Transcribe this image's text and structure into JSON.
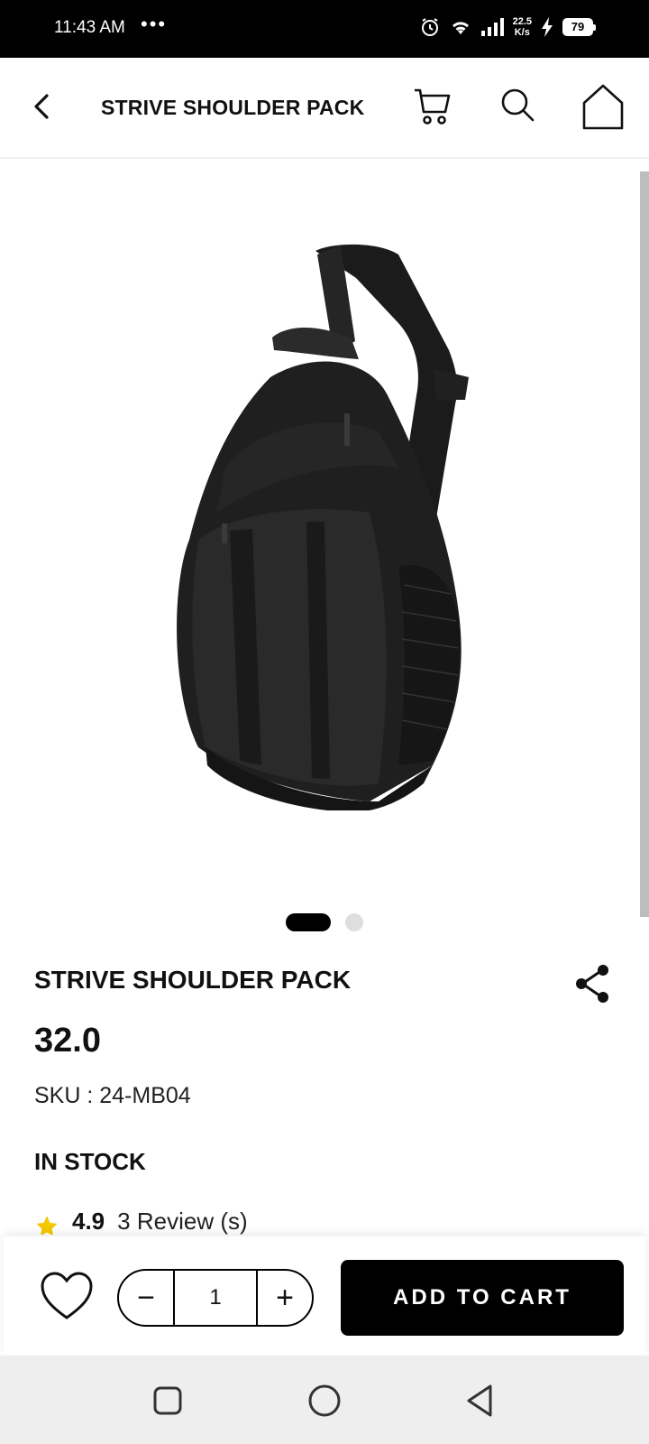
{
  "status_bar": {
    "time": "11:43 AM",
    "dots": "•••",
    "net_speed_value": "22.5",
    "net_speed_unit": "K/s",
    "battery": "79"
  },
  "header": {
    "title": "STRIVE SHOULDER PACK",
    "icons": [
      "back-icon",
      "cart-icon",
      "search-icon",
      "home-icon"
    ]
  },
  "gallery": {
    "image_alt": "STRIVE SHOULDER PACK",
    "page_count": 2,
    "active_page": 1
  },
  "product": {
    "name": "STRIVE SHOULDER PACK",
    "price": "32.0",
    "sku_label": "SKU :",
    "sku_value": "24-MB04",
    "stock_status": "IN STOCK",
    "rating": "4.9",
    "reviews": "3 Review (s)",
    "star_color": "#f5c800"
  },
  "actions": {
    "quantity": "1",
    "minus_label": "−",
    "plus_label": "+",
    "add_to_cart": "ADD TO CART"
  },
  "colors": {
    "primary": "#000000",
    "background": "#ffffff",
    "nav_bar": "#eeeeee"
  }
}
